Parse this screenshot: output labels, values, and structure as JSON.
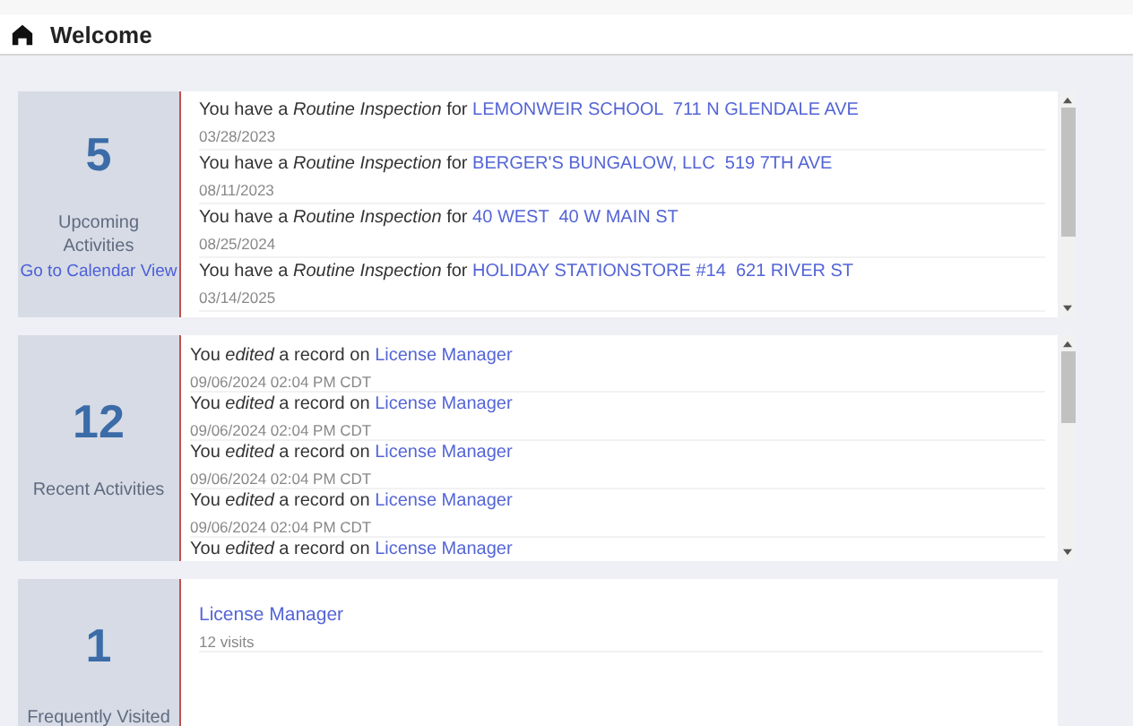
{
  "header": {
    "title": "Welcome"
  },
  "panels": [
    {
      "count": "5",
      "label": "Upcoming Activities",
      "link": "Go to Calendar View",
      "kind": "inspections",
      "items": [
        {
          "text": "You have a *Routine Inspection* for",
          "link": "LEMONWEIR SCHOOL  711 N GLENDALE AVE",
          "meta": "03/28/2023"
        },
        {
          "text": "You have a *Routine Inspection* for",
          "link": "BERGER'S BUNGALOW, LLC  519 7TH AVE",
          "meta": "08/11/2023"
        },
        {
          "text": "You have a *Routine Inspection* for",
          "link": "40 WEST  40 W MAIN ST",
          "meta": "08/25/2024"
        },
        {
          "text": "You have a *Routine Inspection* for",
          "link": "HOLIDAY STATIONSTORE #14  621 RIVER ST",
          "meta": "03/14/2025"
        }
      ]
    },
    {
      "count": "12",
      "label": "Recent Activities",
      "kind": "activities",
      "items": [
        {
          "text": "You *edited* a record on",
          "link": "License Manager",
          "meta": "09/06/2024 02:04 PM CDT"
        },
        {
          "text": "You *edited* a record on",
          "link": "License Manager",
          "meta": "09/06/2024 02:04 PM CDT"
        },
        {
          "text": "You *edited* a record on",
          "link": "License Manager",
          "meta": "09/06/2024 02:04 PM CDT"
        },
        {
          "text": "You *edited* a record on",
          "link": "License Manager",
          "meta": "09/06/2024 02:04 PM CDT"
        },
        {
          "text": "You *edited* a record on",
          "link": "License Manager"
        }
      ]
    },
    {
      "count": "1",
      "label": "Frequently Visited",
      "kind": "visited",
      "items": [
        {
          "link": "License Manager",
          "meta": "12 visits"
        }
      ]
    }
  ]
}
